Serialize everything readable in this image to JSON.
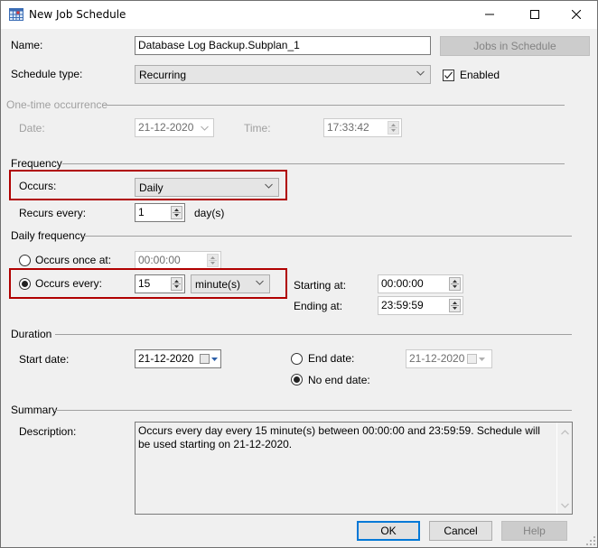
{
  "window": {
    "title": "New Job Schedule",
    "minimize_icon": "minimize-icon",
    "maximize_icon": "maximize-icon",
    "close_icon": "close-icon"
  },
  "general": {
    "name_label": "Name:",
    "name_value": "Database Log Backup.Subplan_1",
    "jobs_in_schedule_label": "Jobs in Schedule",
    "schedule_type_label": "Schedule type:",
    "schedule_type_value": "Recurring",
    "enabled_label": "Enabled",
    "enabled_checked": true
  },
  "one_time": {
    "group_title": "One-time occurrence",
    "date_label": "Date:",
    "date_value": "21-12-2020",
    "time_label": "Time:",
    "time_value": "17:33:42"
  },
  "frequency": {
    "group_title": "Frequency",
    "occurs_label": "Occurs:",
    "occurs_value": "Daily",
    "recurs_every_label": "Recurs every:",
    "recurs_every_value": "1",
    "recurs_unit": "day(s)"
  },
  "daily_frequency": {
    "group_title": "Daily frequency",
    "once_label": "Occurs once at:",
    "once_value": "00:00:00",
    "once_selected": false,
    "every_label": "Occurs every:",
    "every_value": "15",
    "every_unit": "minute(s)",
    "every_selected": true,
    "starting_label": "Starting at:",
    "starting_value": "00:00:00",
    "ending_label": "Ending at:",
    "ending_value": "23:59:59"
  },
  "duration": {
    "group_title": "Duration",
    "start_date_label": "Start date:",
    "start_date_value": "21-12-2020",
    "end_date_label": "End date:",
    "end_date_value": "21-12-2020",
    "end_date_selected": false,
    "no_end_date_label": "No end date:",
    "no_end_date_selected": true
  },
  "summary": {
    "group_title": "Summary",
    "description_label": "Description:",
    "description_value": "Occurs every day every 15 minute(s) between 00:00:00 and 23:59:59. Schedule will be used starting on 21-12-2020."
  },
  "buttons": {
    "ok": "OK",
    "cancel": "Cancel",
    "help": "Help"
  },
  "colors": {
    "highlight_border": "#b00000",
    "default_button_border": "#0078d7"
  }
}
